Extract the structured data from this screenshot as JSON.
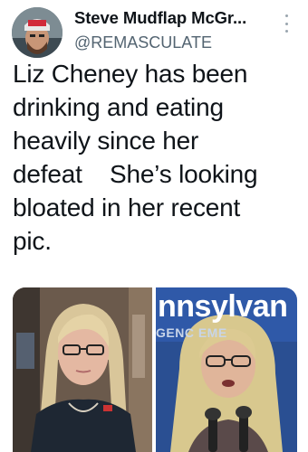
{
  "tweet": {
    "author": {
      "display_name": "Steve Mudflap McGr...",
      "handle": "@REMASCULATE",
      "avatar_icon": "profile-photo"
    },
    "more_icon": "more-options-icon",
    "text": "Liz Cheney has been\ndrinking and eating\nheavily since her\ndefeat    She’s looking\nbloated in her recent\npic.",
    "media": {
      "left_photo": "photo-woman-left",
      "right_photo": "photo-woman-right",
      "right_sign_text": "nnsylvan",
      "right_sign_sub": "GENC            EME"
    }
  }
}
